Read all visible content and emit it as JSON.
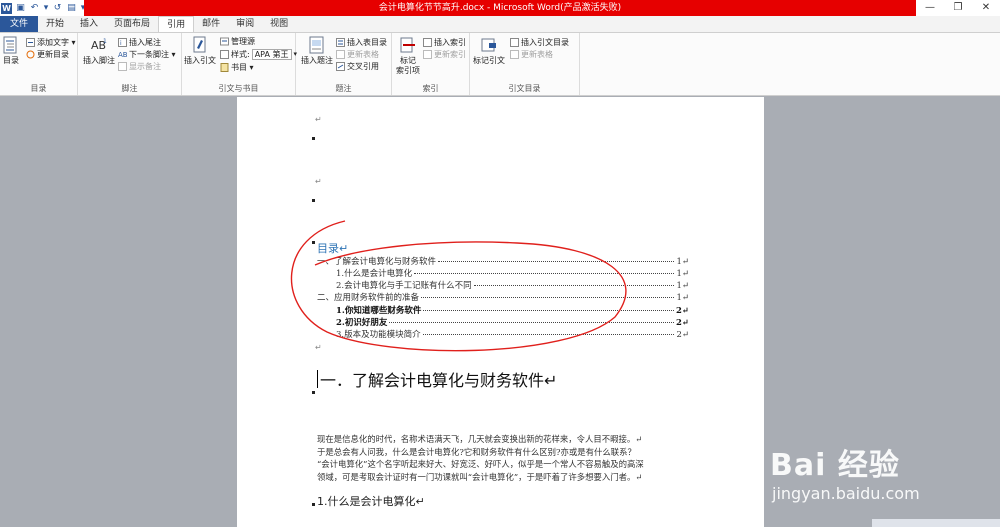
{
  "titlebar": {
    "title": "会计电算化节节高升.docx - Microsoft Word(产品激活失败)",
    "title_bg": "#e60000",
    "qat": [
      {
        "name": "word-logo-icon",
        "glyph": "W"
      },
      {
        "name": "save-icon",
        "glyph": "▣"
      },
      {
        "name": "undo-icon",
        "glyph": "↶"
      },
      {
        "name": "qat-dropdown-icon",
        "glyph": "▾"
      },
      {
        "name": "redo-icon",
        "glyph": "↺"
      },
      {
        "name": "print-icon",
        "glyph": "▤"
      },
      {
        "name": "customize-qat-icon",
        "glyph": "▾"
      }
    ],
    "controls": [
      "—",
      "❐",
      "✕"
    ]
  },
  "tabs": [
    {
      "label": "文件",
      "kind": "file"
    },
    {
      "label": "开始"
    },
    {
      "label": "插入"
    },
    {
      "label": "页面布局"
    },
    {
      "label": "引用",
      "active": true
    },
    {
      "label": "邮件"
    },
    {
      "label": "审阅"
    },
    {
      "label": "视图"
    }
  ],
  "ribbon": {
    "toc": {
      "big_label": "目录",
      "add_text": "添加文字 ▾",
      "update_toc": "更新目录",
      "group": "目录"
    },
    "footnote": {
      "insert_footnote": "插入脚注",
      "insert_endnote": "插入尾注",
      "next_footnote": "下一条脚注 ▾",
      "show_notes": "显示备注",
      "group": "脚注"
    },
    "citation": {
      "insert_citation": "插入引文",
      "manage_sources": "管理源",
      "style_label": "样式:",
      "style_value": "APA 第王",
      "bibliography": "书目 ▾",
      "group": "引文与书目"
    },
    "caption": {
      "insert_caption": "插入题注",
      "insert_table_of_figures": "插入表目录",
      "update_table": "更新表格",
      "cross_reference": "交叉引用",
      "group": "题注"
    },
    "index": {
      "mark_entry_1": "标记",
      "mark_entry_2": "索引项",
      "insert_index": "插入索引",
      "update_index": "更新索引",
      "group": "索引"
    },
    "authorities": {
      "mark_citation": "标记引文",
      "insert_toa": "插入引文目录",
      "update_table": "更新表格",
      "group": "引文目录"
    }
  },
  "document": {
    "para_mark": "↵",
    "toc_title": "目录↵",
    "toc_entries": [
      {
        "text": "一、了解会计电算化与财务软件",
        "page": "1↵",
        "level": 1,
        "bold": false
      },
      {
        "text": "1.什么是会计电算化",
        "page": "1↵",
        "level": 2,
        "bold": false
      },
      {
        "text": "2.会计电算化与手工记账有什么不同",
        "page": "1↵",
        "level": 2,
        "bold": false
      },
      {
        "text": "二、应用财务软件前的准备",
        "page": "1↵",
        "level": 1,
        "bold": false
      },
      {
        "text": "1.你知道哪些财务软件",
        "page": "2↵",
        "level": 2,
        "bold": true
      },
      {
        "text": "2.初识好朋友",
        "page": "2↵",
        "level": 2,
        "bold": true
      },
      {
        "text": "3.版本及功能模块简介",
        "page": "2↵",
        "level": 2,
        "bold": false
      }
    ],
    "heading1": "一．了解会计电算化与财务软件↵",
    "paragraph_lines": [
      "现在是信息化的时代，名称术语满天飞，几天就会变换出新的花样来，令人目不暇接。↵",
      "于是总会有人问我，什么是会计电算化?它和财务软件有什么区别?亦或是有什么联系？",
      "“会计电算化”这个名字听起来好大、好宽泛、好吓人，似乎是一个常人不容易触及的高深",
      "领域，可是考取会计证时有一门功课就叫“会计电算化”，于是吓着了许多想要入门者。↵"
    ],
    "heading2": "1.什么是会计电算化↵",
    "annotation_color": "#e0201c"
  },
  "watermark": {
    "logo": "Bai 经验",
    "url": "jingyan.baidu.com"
  }
}
